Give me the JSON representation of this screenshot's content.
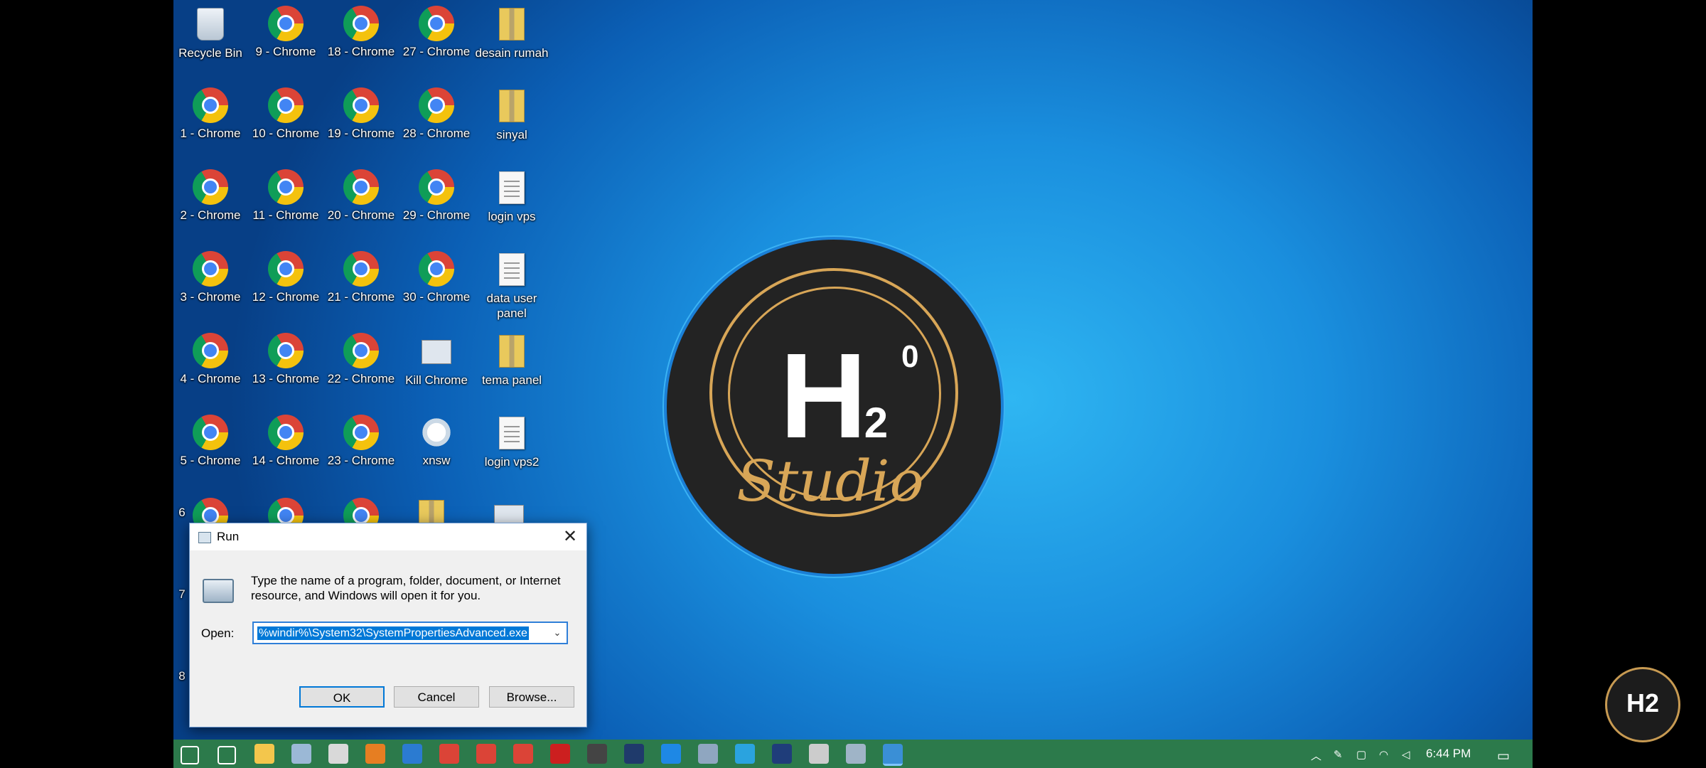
{
  "desktop": {
    "icons": [
      {
        "label": "Recycle Bin",
        "kind": "recycle"
      },
      {
        "label": "9 - Chrome",
        "kind": "chrome"
      },
      {
        "label": "18 - Chrome",
        "kind": "chrome"
      },
      {
        "label": "27 - Chrome",
        "kind": "chrome"
      },
      {
        "label": "desain rumah",
        "kind": "zip"
      },
      {
        "label": "1 - Chrome",
        "kind": "chrome"
      },
      {
        "label": "10 - Chrome",
        "kind": "chrome"
      },
      {
        "label": "19 - Chrome",
        "kind": "chrome"
      },
      {
        "label": "28 - Chrome",
        "kind": "chrome"
      },
      {
        "label": "sinyal",
        "kind": "zip"
      },
      {
        "label": "2 - Chrome",
        "kind": "chrome"
      },
      {
        "label": "11 - Chrome",
        "kind": "chrome"
      },
      {
        "label": "20 - Chrome",
        "kind": "chrome"
      },
      {
        "label": "29 - Chrome",
        "kind": "chrome"
      },
      {
        "label": "login vps",
        "kind": "file"
      },
      {
        "label": "3 - Chrome",
        "kind": "chrome"
      },
      {
        "label": "12 - Chrome",
        "kind": "chrome"
      },
      {
        "label": "21 - Chrome",
        "kind": "chrome"
      },
      {
        "label": "30 - Chrome",
        "kind": "chrome"
      },
      {
        "label": "data user panel",
        "kind": "file"
      },
      {
        "label": "4 - Chrome",
        "kind": "chrome"
      },
      {
        "label": "13 - Chrome",
        "kind": "chrome"
      },
      {
        "label": "22 - Chrome",
        "kind": "chrome"
      },
      {
        "label": "Kill Chrome",
        "kind": "gears"
      },
      {
        "label": "tema panel",
        "kind": "zip"
      },
      {
        "label": "5 - Chrome",
        "kind": "chrome"
      },
      {
        "label": "14 - Chrome",
        "kind": "chrome"
      },
      {
        "label": "23 - Chrome",
        "kind": "chrome"
      },
      {
        "label": "xnsw",
        "kind": "xnsw"
      },
      {
        "label": "login vps2",
        "kind": "file"
      }
    ],
    "partial_icons": [
      {
        "label": "6",
        "kind": "chrome"
      },
      {
        "label": "7",
        "kind": "chrome"
      },
      {
        "label": "8",
        "kind": "chrome"
      }
    ]
  },
  "wallpaper_logo": {
    "main": "H",
    "sub": "2",
    "sup": "0",
    "script": "Studio"
  },
  "run_dialog": {
    "title": "Run",
    "description": "Type the name of a program, folder, document, or Internet resource, and Windows will open it for you.",
    "open_label": "Open:",
    "open_value": "%windir%\\System32\\SystemPropertiesAdvanced.exe",
    "ok_label": "OK",
    "cancel_label": "Cancel",
    "browse_label": "Browse..."
  },
  "taskbar": {
    "clock": "6:44 PM",
    "pinned": [
      "start-icon",
      "search-icon",
      "file-explorer-icon",
      "app-icon",
      "app-icon",
      "app-icon",
      "vscode-icon",
      "chrome-icon",
      "chrome-icon",
      "chrome-icon",
      "record-icon",
      "app-icon",
      "photoshop-icon",
      "teamviewer-icon",
      "app-icon",
      "telegram-icon",
      "powershell-icon",
      "app-icon",
      "app-icon",
      "run-icon"
    ]
  },
  "watermark": {
    "text": "H2"
  },
  "colors": {
    "taskbar": "#2c7a4b",
    "accent": "#0078d7",
    "logo_gold": "#d8a657"
  }
}
